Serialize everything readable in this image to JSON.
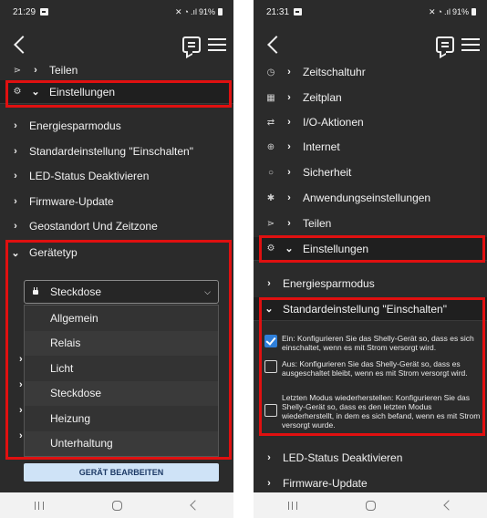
{
  "left": {
    "status": {
      "time": "21:29",
      "battery": "91%"
    },
    "rows": {
      "teilen": "Teilen",
      "einstellungen": "Einstellungen",
      "energiesparmodus": "Energiesparmodus",
      "standardeinstellung": "Standardeinstellung \"Einschalten\"",
      "led": "LED-Status Deaktivieren",
      "firmware": "Firmware-Update",
      "geostandort": "Geostandort Und Zeitzone",
      "geraetetyp": "Gerätetyp"
    },
    "dropdown": {
      "selected": "Steckdose",
      "options": [
        "Allgemein",
        "Relais",
        "Licht",
        "Steckdose",
        "Heizung",
        "Unterhaltung"
      ]
    },
    "edit_button": "GERÄT BEARBEITEN"
  },
  "right": {
    "status": {
      "time": "21:31",
      "battery": "91%"
    },
    "rows": {
      "zeitschaltuhr": "Zeitschaltuhr",
      "zeitplan": "Zeitplan",
      "io_aktionen": "I/O-Aktionen",
      "internet": "Internet",
      "sicherheit": "Sicherheit",
      "anwendungseinstellungen": "Anwendungseinstellungen",
      "teilen": "Teilen",
      "einstellungen": "Einstellungen",
      "energiesparmodus": "Energiesparmodus",
      "standardeinstellung": "Standardeinstellung \"Einschalten\"",
      "led": "LED-Status Deaktivieren",
      "firmware": "Firmware-Update"
    },
    "options": {
      "ein": "Ein: Konfigurieren Sie das Shelly-Gerät so, dass es sich einschaltet, wenn es mit Strom versorgt wird.",
      "aus": "Aus: Konfigurieren Sie das Shelly-Gerät so, dass es ausgeschaltet bleibt, wenn es mit Strom versorgt wird.",
      "letzter": "Letzten Modus wiederherstellen: Konfigurieren Sie das Shelly-Gerät so, dass es den letzten Modus wiederherstellt, in dem es sich befand, wenn es mit Strom versorgt wurde."
    },
    "options_checked": {
      "ein": true,
      "aus": false,
      "letzter": false
    }
  },
  "colors": {
    "background": "#2b2b2b",
    "highlight": "#e01010",
    "checkbox_checked": "#2f7fd9",
    "edit_button_bg": "#cfe3f7"
  },
  "icons": {
    "status_left": [
      "image-icon"
    ],
    "status_right": [
      "mute-icon",
      "wifi-icon",
      "signal-icon",
      "battery-icon"
    ],
    "appbar": [
      "back-icon",
      "chat-icon",
      "menu-icon"
    ],
    "navbar": [
      "recent-apps-icon",
      "home-icon",
      "back-nav-icon"
    ]
  }
}
